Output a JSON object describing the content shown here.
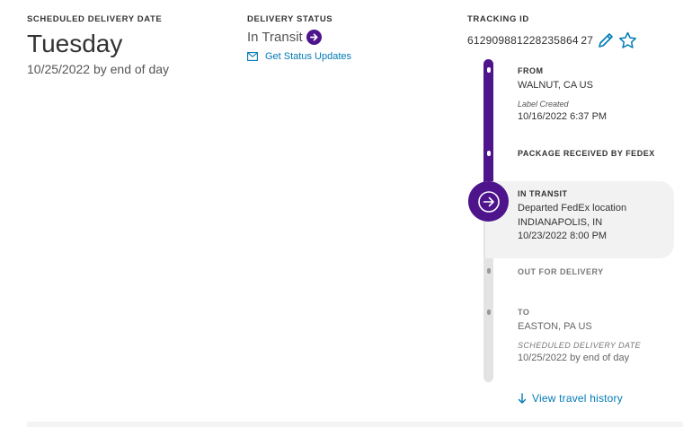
{
  "schedule": {
    "label": "SCHEDULED DELIVERY DATE",
    "day": "Tuesday",
    "date_line": "10/25/2022 by end of day"
  },
  "status": {
    "label": "DELIVERY STATUS",
    "value": "In Transit",
    "updates_link": "Get Status Updates",
    "icons": {
      "status_arrow": "arrow-right-circle-icon",
      "updates": "envelope-icon"
    }
  },
  "tracking": {
    "label": "TRACKING ID",
    "number": "612909881228235864 27",
    "icons": {
      "edit": "pencil-icon",
      "favorite": "star-icon"
    }
  },
  "timeline": {
    "from": {
      "title": "FROM",
      "location": "WALNUT, CA US",
      "sub_label": "Label Created",
      "datetime": "10/16/2022 6:37 PM"
    },
    "received": {
      "title": "PACKAGE RECEIVED BY FEDEX"
    },
    "in_transit": {
      "title": "IN TRANSIT",
      "detail": "Departed FedEx location",
      "location": "INDIANAPOLIS, IN",
      "datetime": "10/23/2022 8:00 PM"
    },
    "out_for_delivery": {
      "title": "OUT FOR DELIVERY"
    },
    "to": {
      "title": "TO",
      "location": "EASTON, PA US",
      "sub_label": "SCHEDULED DELIVERY DATE",
      "datetime": "10/25/2022 by end of day"
    },
    "history_link": "View travel history"
  },
  "colors": {
    "brand_purple": "#4d148c",
    "link_blue": "#007ab7",
    "rail_grey": "#e3e3e3",
    "card_grey": "#f2f2f2"
  }
}
